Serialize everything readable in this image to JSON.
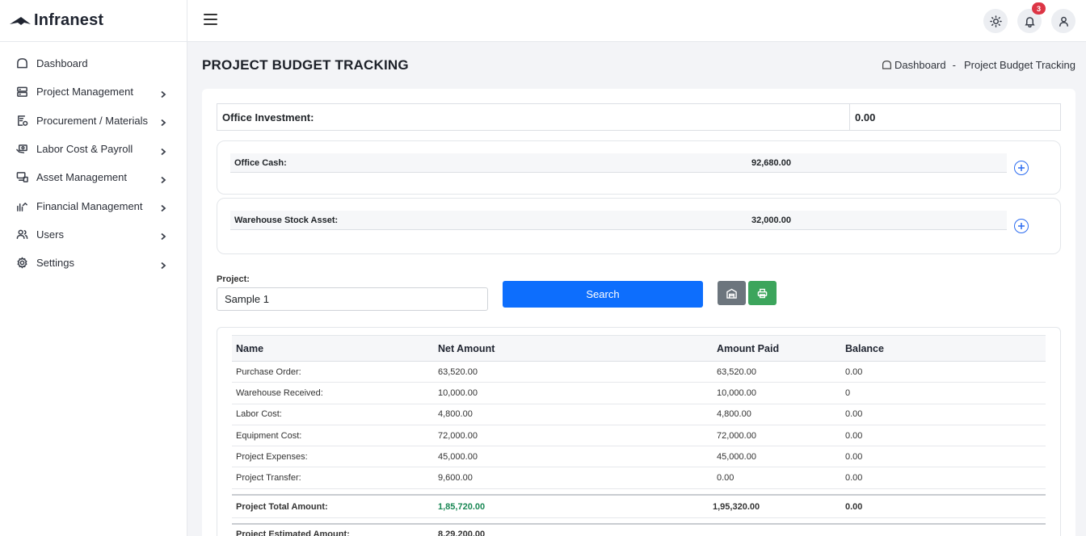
{
  "brand": {
    "name": "Infranest"
  },
  "sidebar": {
    "items": [
      {
        "label": "Dashboard",
        "icon": "home-icon",
        "has_children": false
      },
      {
        "label": "Project Management",
        "icon": "server-icon",
        "has_children": true
      },
      {
        "label": "Procurement / Materials",
        "icon": "clipboard-check-icon",
        "has_children": true
      },
      {
        "label": "Labor Cost & Payroll",
        "icon": "cash-hand-icon",
        "has_children": true
      },
      {
        "label": "Asset Management",
        "icon": "monitor-icon",
        "has_children": true
      },
      {
        "label": "Financial Management",
        "icon": "chart-up-icon",
        "has_children": true
      },
      {
        "label": "Users",
        "icon": "users-icon",
        "has_children": true
      },
      {
        "label": "Settings",
        "icon": "gear-icon",
        "has_children": true
      }
    ]
  },
  "header": {
    "notification_count": "3"
  },
  "page": {
    "title": "PROJECT BUDGET TRACKING",
    "breadcrumb": {
      "home": "Dashboard",
      "separator": "-",
      "current": "Project Budget Tracking"
    }
  },
  "summary": {
    "office_investment": {
      "label": "Office Investment:",
      "value": "0.00"
    },
    "office_cash": {
      "label": "Office Cash:",
      "value": "92,680.00"
    },
    "warehouse_stock": {
      "label": "Warehouse Stock Asset:",
      "value": "32,000.00"
    }
  },
  "filter": {
    "project_label": "Project:",
    "project_value": "Sample 1",
    "search_label": "Search"
  },
  "table": {
    "headers": [
      "Name",
      "Net Amount",
      "Amount Paid",
      "Balance"
    ],
    "rows": [
      [
        "Purchase Order:",
        "63,520.00",
        "63,520.00",
        "0.00"
      ],
      [
        "Warehouse Received:",
        "10,000.00",
        "10,000.00",
        "0"
      ],
      [
        "Labor Cost:",
        "4,800.00",
        "4,800.00",
        "0.00"
      ],
      [
        "Equipment Cost:",
        "72,000.00",
        "72,000.00",
        "0.00"
      ],
      [
        "Project Expenses:",
        "45,000.00",
        "45,000.00",
        "0.00"
      ],
      [
        "Project Transfer:",
        "9,600.00",
        "0.00",
        "0.00"
      ]
    ],
    "total": [
      "Project Total Amount:",
      "1,85,720.00",
      "1,95,320.00",
      "0.00"
    ],
    "estimated": [
      "Project Estimated Amount:",
      "8,29,200.00"
    ]
  },
  "colors": {
    "primary": "#0d6efd",
    "success": "#3ca55c",
    "secondary": "#6c757d",
    "badge": "#dc3545",
    "total_green": "#198754"
  }
}
